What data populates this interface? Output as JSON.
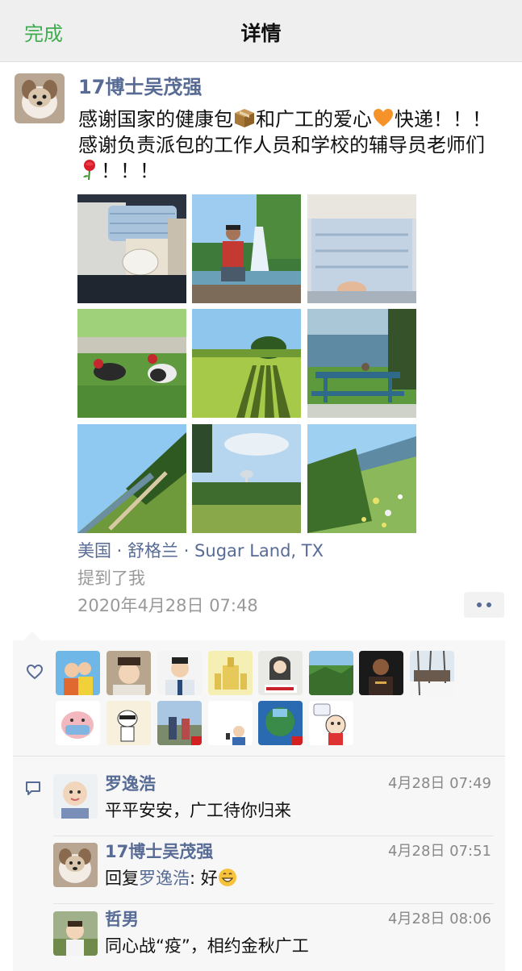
{
  "nav": {
    "done_label": "完成",
    "title": "详情"
  },
  "post": {
    "author": "17博士吴茂强",
    "text_part1": "感谢国家的健康包",
    "text_part2": "和广工的爱心",
    "text_part3": "快递！！！ 感谢负责派包的工作人员和学校的辅导员老师们",
    "text_part4": "！！！",
    "emojis": [
      "package-emoji",
      "orange-heart-emoji",
      "rose-emoji"
    ],
    "photos": [
      "masks-and-supplies",
      "man-at-waterfall",
      "mask-packages",
      "ducks-on-grass",
      "shadows-on-lawn",
      "lake-picnic-table",
      "tilted-tree-field",
      "park-water-tower",
      "wildflowers-field"
    ],
    "location": "美国 · 舒格兰 · Sugar Land, TX",
    "mention": "提到了我",
    "timestamp": "2020年4月28日 07:48"
  },
  "likes": {
    "count": 15
  },
  "comments": [
    {
      "name": "罗逸浩",
      "time": "4月28日 07:49",
      "text": "平平安安，广工待你归来"
    },
    {
      "name": "17博士吴茂强",
      "time": "4月28日 07:51",
      "reply_prefix": "回复",
      "reply_to": "罗逸浩",
      "reply_text": ": 好"
    },
    {
      "name": "哲男",
      "time": "4月28日 08:06",
      "text": "同心战“疫”，相约金秋广工"
    }
  ],
  "colors": {
    "link": "#576b95",
    "accent_green": "#3fad4f",
    "panel": "#f7f7f7"
  }
}
